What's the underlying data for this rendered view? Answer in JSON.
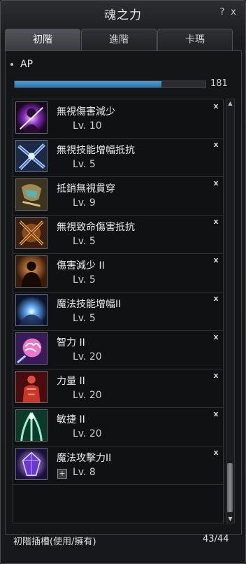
{
  "window": {
    "title": "魂之力",
    "help_label": "?",
    "close_label": "x"
  },
  "tabs": [
    {
      "label": "初階",
      "active": true
    },
    {
      "label": "進階",
      "active": false
    },
    {
      "label": "卡瑪",
      "active": false
    }
  ],
  "ap": {
    "label": "AP",
    "value": "181",
    "fill_fraction": 0.77,
    "bar_color": "#3f8cc8"
  },
  "items": [
    {
      "name": "無視傷害減少",
      "level": "Lv. 10",
      "icon": "purple-aura-figure-icon"
    },
    {
      "name": "無視技能增幅抵抗",
      "level": "Lv. 5",
      "icon": "crossed-blades-icon"
    },
    {
      "name": "抵銷無視貫穿",
      "level": "Lv. 9",
      "icon": "armored-gauntlet-icon"
    },
    {
      "name": "無視致命傷害抵抗",
      "level": "Lv. 5",
      "icon": "crossed-swords-fire-icon"
    },
    {
      "name": "傷害減少 II",
      "level": "Lv. 5",
      "icon": "silhouette-figure-icon"
    },
    {
      "name": "魔法技能增幅II",
      "level": "Lv. 5",
      "icon": "blue-orb-icon"
    },
    {
      "name": "智力 II",
      "level": "Lv. 20",
      "icon": "pink-brain-icon"
    },
    {
      "name": "力量 II",
      "level": "Lv. 20",
      "icon": "red-muscle-icon"
    },
    {
      "name": "敏捷 II",
      "level": "Lv. 20",
      "icon": "green-speed-icon"
    },
    {
      "name": "魔法攻擊力II",
      "level": "Lv. 8",
      "icon": "purple-crystal-icon",
      "has_plus": true,
      "plus_label": "+"
    }
  ],
  "remove_label": "x",
  "footer": {
    "label": "初階插槽(使用/擁有)",
    "count": "43/44"
  },
  "scrollbar": {
    "up": "▲",
    "down": "▼"
  }
}
